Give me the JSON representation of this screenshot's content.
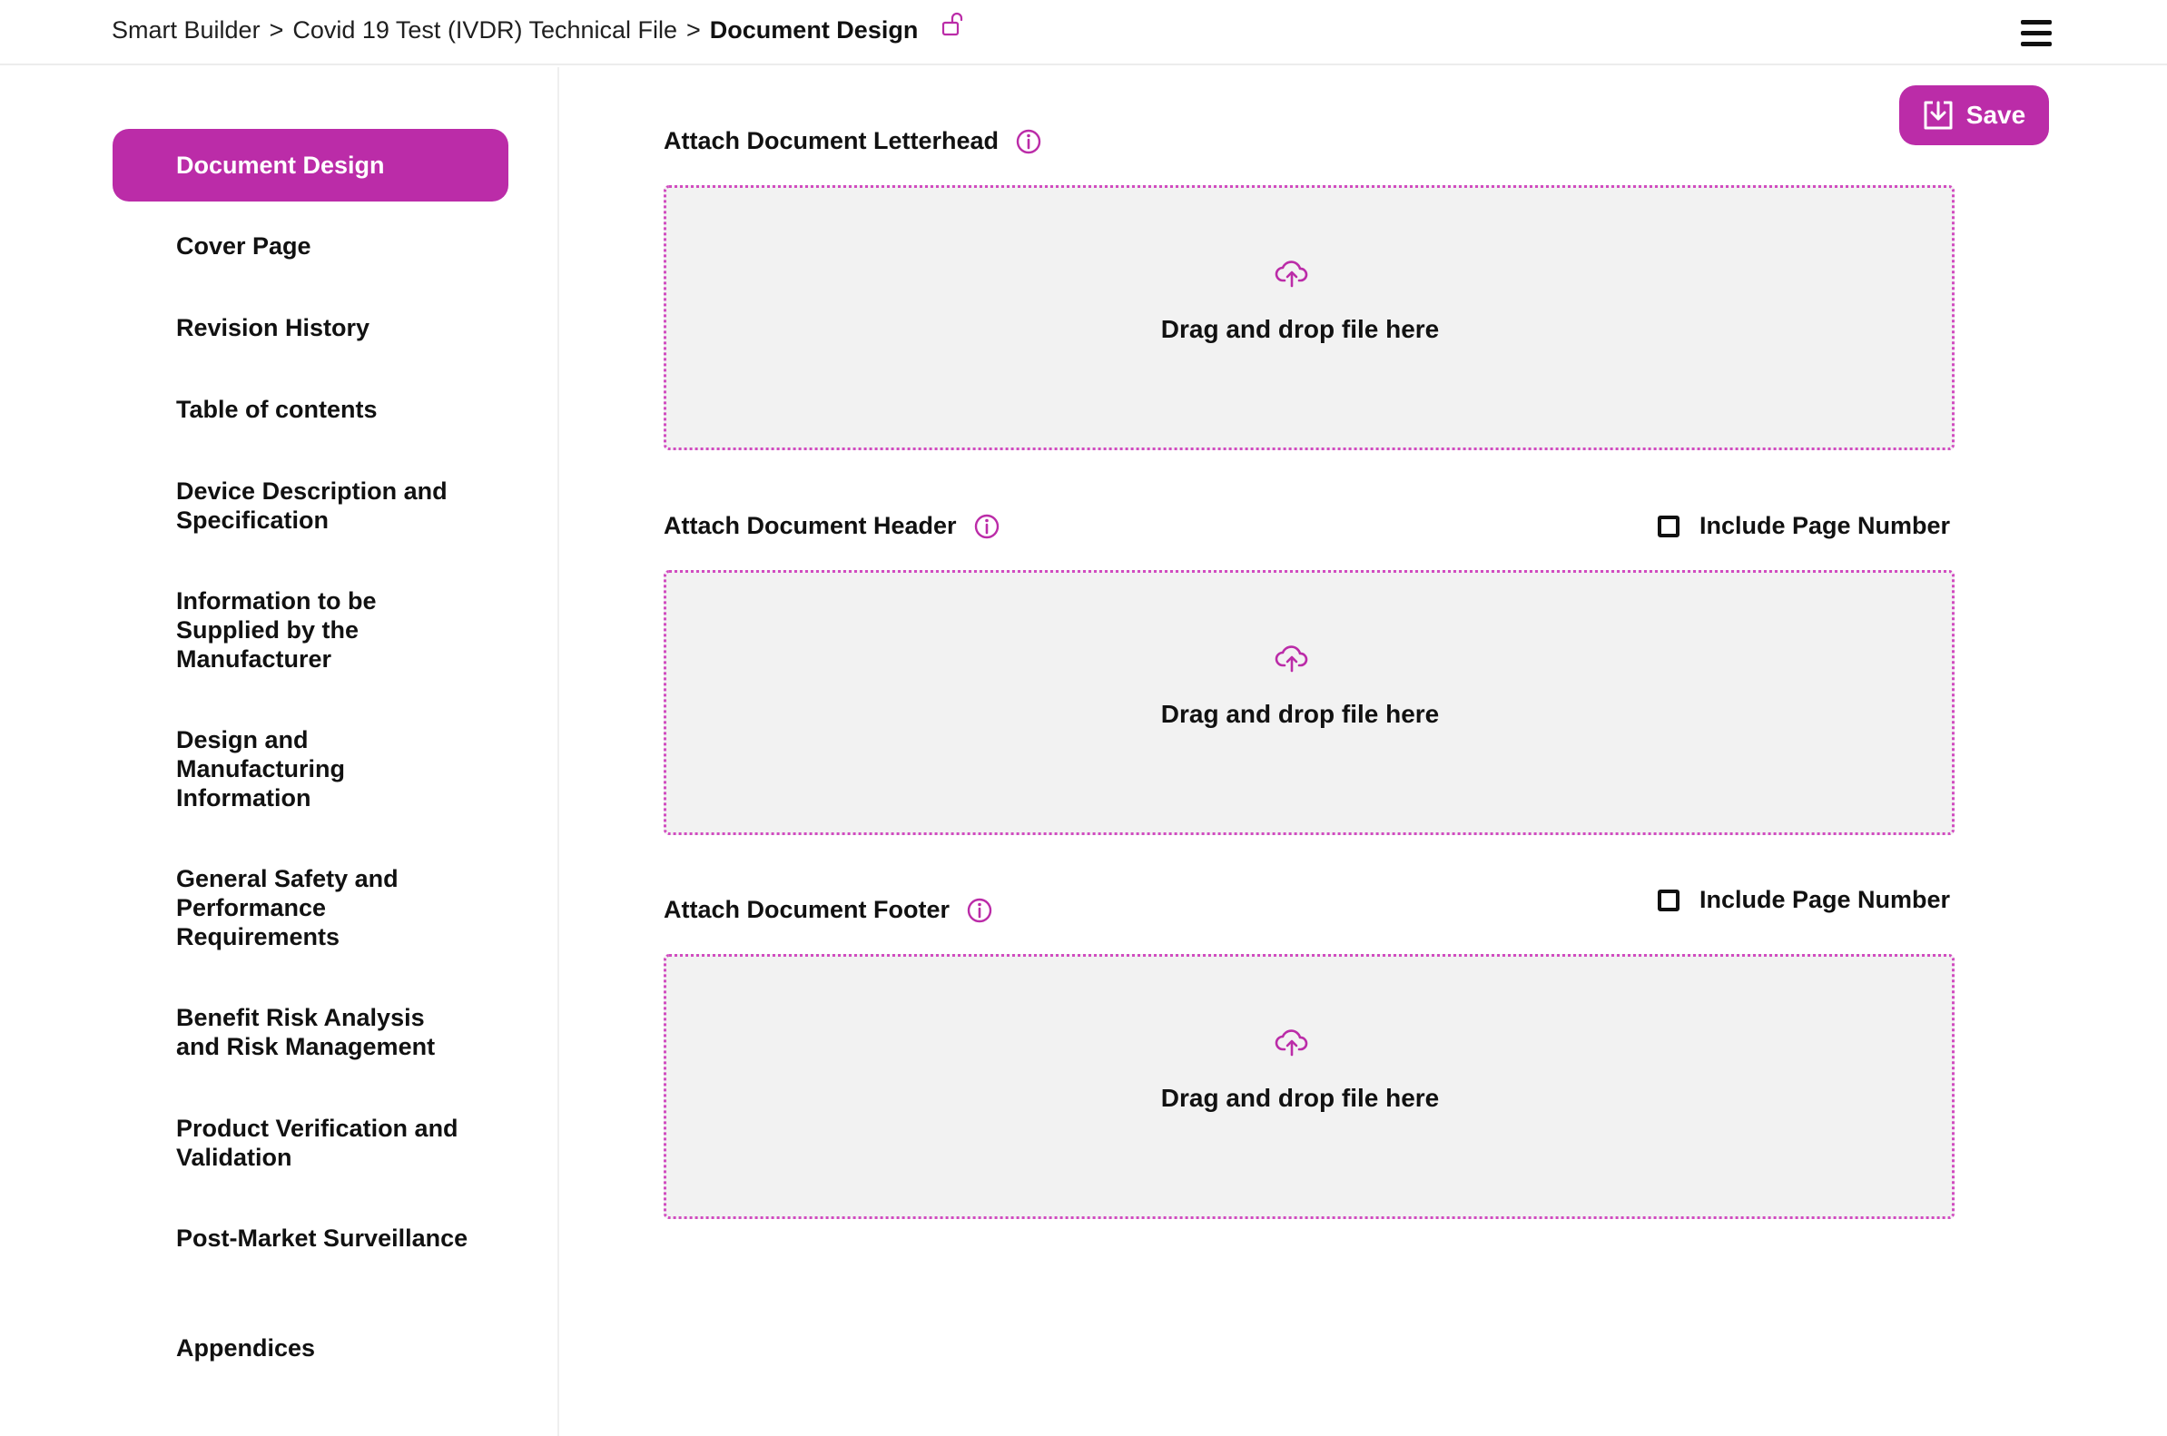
{
  "breadcrumb": {
    "items": [
      "Smart Builder",
      "Covid 19 Test (IVDR) Technical File"
    ],
    "separator": ">",
    "current": "Document Design",
    "lock_icon": "unlock-icon"
  },
  "header": {
    "menu_icon": "hamburger-menu-icon"
  },
  "sidebar": {
    "items": [
      {
        "label": "Document Design",
        "active": true
      },
      {
        "label": "Cover Page"
      },
      {
        "label": "Revision History"
      },
      {
        "label": "Table of contents"
      },
      {
        "label": "Device Description and Specification"
      },
      {
        "label": "Information to be Supplied by the Manufacturer"
      },
      {
        "label": "Design and Manufacturing Information"
      },
      {
        "label": "General Safety and Performance Requirements"
      },
      {
        "label": "Benefit Risk Analysis and Risk Management"
      },
      {
        "label": "Product Verification and Validation"
      },
      {
        "label": "Post-Market Surveillance"
      },
      {
        "label": "Appendices"
      }
    ]
  },
  "toolbar": {
    "save_label": "Save",
    "save_icon": "download-save-icon"
  },
  "sections": {
    "letterhead": {
      "label": "Attach Document Letterhead",
      "dropzone_text": "Drag and drop file here"
    },
    "header": {
      "label": "Attach Document Header",
      "checkbox_label": "Include Page Number",
      "checked": false,
      "dropzone_text": "Drag and drop file here"
    },
    "footer": {
      "label": "Attach Document Footer",
      "checkbox_label": "Include Page Number",
      "checked": false,
      "dropzone_text": "Drag and drop file here"
    }
  },
  "colors": {
    "accent": "#bb2ca8",
    "dropzone_bg": "#f2f2f2",
    "dropzone_border": "#d14cc0"
  }
}
